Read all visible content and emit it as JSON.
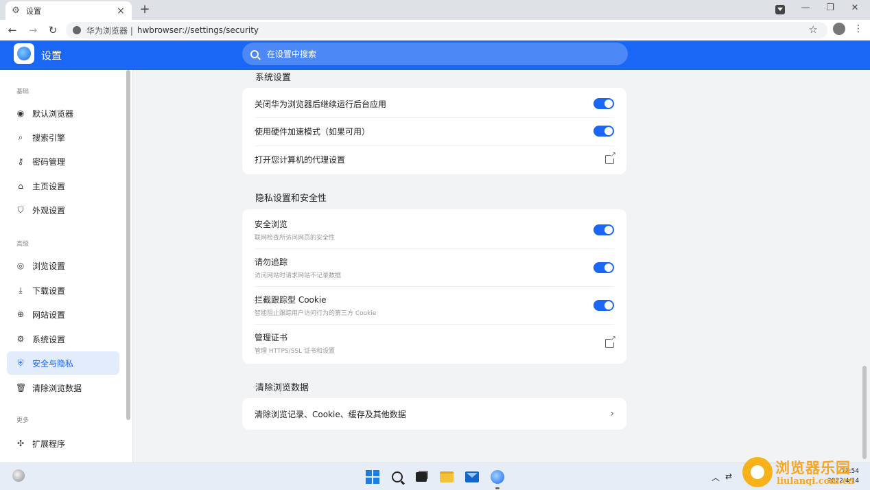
{
  "tab": {
    "title": "设置",
    "close": "×",
    "new_tab": "+"
  },
  "window": {
    "minimize": "—",
    "maximize": "❐",
    "close": "✕"
  },
  "toolbar": {
    "back": "←",
    "forward": "→",
    "reload": "↻",
    "url_prefix": "华为浏览器 |",
    "url": "hwbrowser://settings/security",
    "star": "☆",
    "menu": "⋮"
  },
  "header": {
    "title": "设置",
    "search_placeholder": "在设置中搜索"
  },
  "sidebar": {
    "groups": [
      "基础",
      "高级",
      "更多"
    ],
    "items": [
      {
        "icon": "◉",
        "label": "默认浏览器"
      },
      {
        "icon": "⌕",
        "label": "搜索引擎"
      },
      {
        "icon": "⚷",
        "label": "密码管理"
      },
      {
        "icon": "⌂",
        "label": "主页设置"
      },
      {
        "icon": "⛉",
        "label": "外观设置"
      },
      {
        "icon": "◎",
        "label": "浏览设置"
      },
      {
        "icon": "⤓",
        "label": "下载设置"
      },
      {
        "icon": "⊕",
        "label": "网站设置"
      },
      {
        "icon": "⚙",
        "label": "系统设置"
      },
      {
        "icon": "⛨",
        "label": "安全与隐私"
      },
      {
        "icon": "🗑",
        "label": "清除浏览数据"
      },
      {
        "icon": "✣",
        "label": "扩展程序"
      }
    ],
    "active_index": 9
  },
  "main": {
    "system": {
      "title": "系统设置",
      "rows": [
        {
          "title": "关闭华为浏览器后继续运行后台应用",
          "on": true
        },
        {
          "title": "使用硬件加速模式（如果可用）",
          "on": true
        },
        {
          "title": "打开您计算机的代理设置"
        }
      ]
    },
    "privacy": {
      "title": "隐私设置和安全性",
      "rows": [
        {
          "title": "安全浏览",
          "sub": "联网检查所访问网页的安全性",
          "on": true
        },
        {
          "title": "请勿追踪",
          "sub": "访问网站时请求网站不记录数据",
          "on": true
        },
        {
          "title": "拦截跟踪型 Cookie",
          "sub": "智能阻止跟踪用户访问行为的第三方 Cookie",
          "on": true
        },
        {
          "title": "管理证书",
          "sub": "管理 HTTPS/SSL 证书和设置"
        }
      ]
    },
    "clear": {
      "title": "清除浏览数据",
      "rows": [
        {
          "title": "清除浏览记录、Cookie、缓存及其他数据"
        }
      ],
      "chevron": "›"
    }
  },
  "taskbar": {
    "tray": {
      "up": "︿",
      "network": "⇄",
      "clock_time": "12:54",
      "clock_date": "2022/4/14"
    }
  },
  "watermark": {
    "text": "浏览器乐园",
    "sub": "liulanqi.com.cn"
  }
}
